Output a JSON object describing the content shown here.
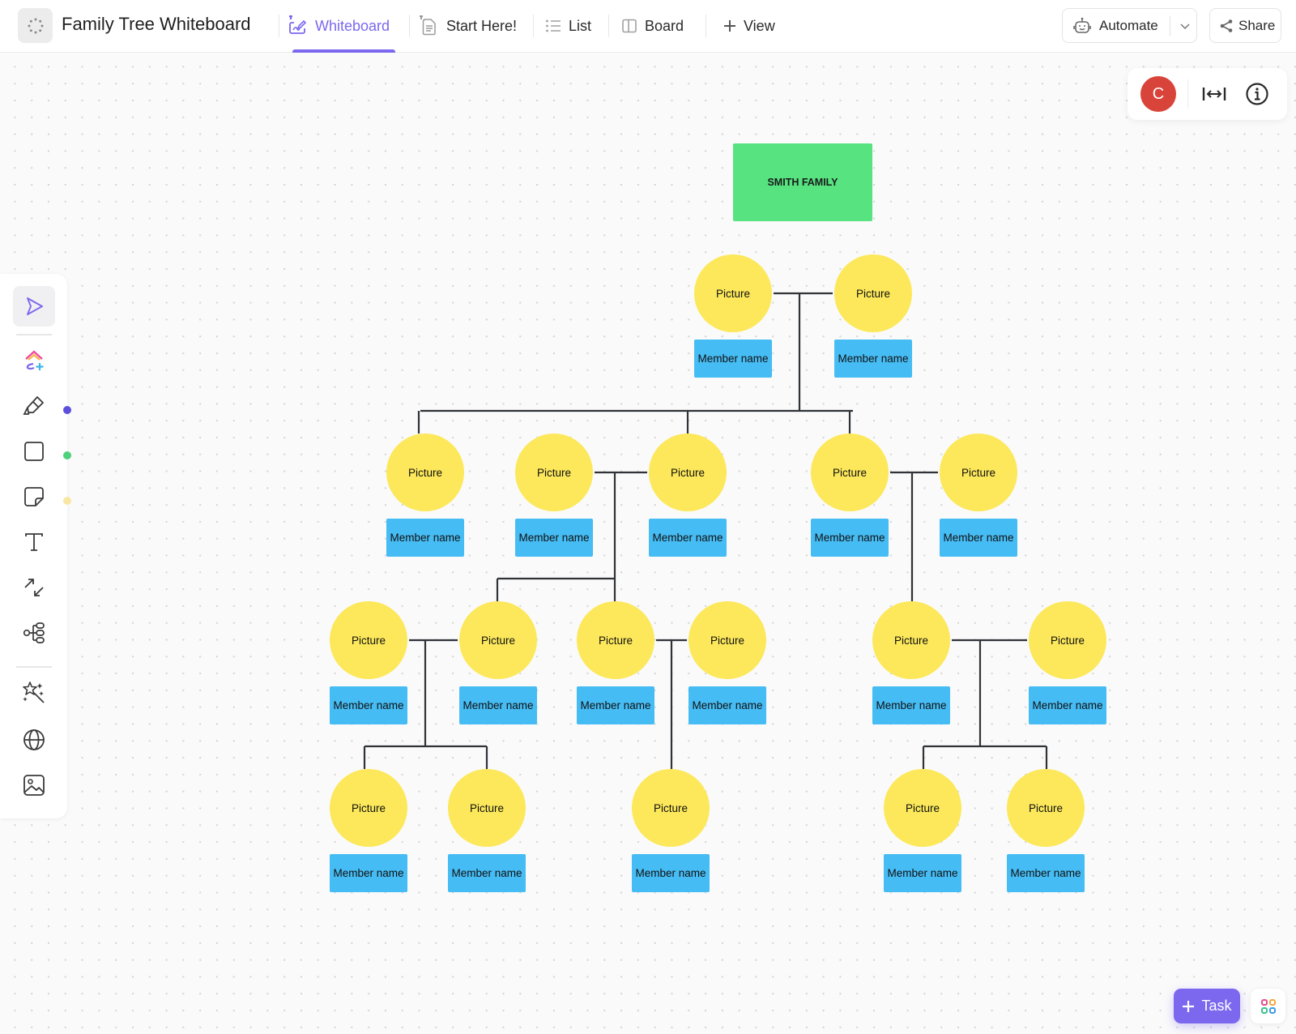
{
  "header": {
    "title": "Family Tree Whiteboard",
    "tabs": [
      {
        "label": "Whiteboard",
        "icon": "whiteboard-icon",
        "active": true,
        "pinned": true
      },
      {
        "label": "Start Here!",
        "icon": "doc-icon",
        "active": false,
        "pinned": true
      },
      {
        "label": "List",
        "icon": "list-icon",
        "active": false
      },
      {
        "label": "Board",
        "icon": "board-icon",
        "active": false
      },
      {
        "label": "View",
        "icon": "plus-icon",
        "active": false
      }
    ],
    "automate_label": "Automate",
    "share_label": "Share",
    "accent_color": "#7b68ee"
  },
  "toolbar": {
    "tools": [
      {
        "name": "select",
        "icon": "cursor-icon",
        "active": true
      },
      {
        "name": "clickup-ai",
        "icon": "ai-create-icon"
      },
      {
        "name": "pen",
        "icon": "pen-icon",
        "color": "#5b4fdc"
      },
      {
        "name": "shape",
        "icon": "square-icon",
        "color": "#4ed17a"
      },
      {
        "name": "sticky-note",
        "icon": "sticky-note-icon",
        "color": "#f8e7a4"
      },
      {
        "name": "text",
        "icon": "text-icon"
      },
      {
        "name": "connector",
        "icon": "connector-arrows-icon"
      },
      {
        "name": "mind-map",
        "icon": "mind-map-icon"
      },
      {
        "name": "ai-magic",
        "icon": "magic-wand-icon"
      },
      {
        "name": "embed",
        "icon": "globe-icon"
      },
      {
        "name": "image",
        "icon": "image-icon"
      }
    ]
  },
  "floating": {
    "avatar_initial": "C",
    "avatar_color": "#d9443a"
  },
  "footer": {
    "task_label": "Task"
  },
  "diagram": {
    "title": "SMITH FAMILY",
    "colors": {
      "title": "#56e380",
      "picture": "#fce85a",
      "name": "#46bcf4",
      "connector": "#2f3337"
    },
    "picture_label": "Picture",
    "name_label": "Member name",
    "members": [
      {
        "id": "g1a",
        "gen": 1,
        "picture": "Picture",
        "name": "Member name"
      },
      {
        "id": "g1b",
        "gen": 1,
        "picture": "Picture",
        "name": "Member name"
      },
      {
        "id": "g2a",
        "gen": 2,
        "picture": "Picture",
        "name": "Member name"
      },
      {
        "id": "g2b",
        "gen": 2,
        "picture": "Picture",
        "name": "Member name"
      },
      {
        "id": "g2c",
        "gen": 2,
        "picture": "Picture",
        "name": "Member name"
      },
      {
        "id": "g2d",
        "gen": 2,
        "picture": "Picture",
        "name": "Member name"
      },
      {
        "id": "g2e",
        "gen": 2,
        "picture": "Picture",
        "name": "Member name"
      },
      {
        "id": "g3a",
        "gen": 3,
        "picture": "Picture",
        "name": "Member name"
      },
      {
        "id": "g3b",
        "gen": 3,
        "picture": "Picture",
        "name": "Member name"
      },
      {
        "id": "g3c",
        "gen": 3,
        "picture": "Picture",
        "name": "Member name"
      },
      {
        "id": "g3d",
        "gen": 3,
        "picture": "Picture",
        "name": "Member name"
      },
      {
        "id": "g3e",
        "gen": 3,
        "picture": "Picture",
        "name": "Member name"
      },
      {
        "id": "g3f",
        "gen": 3,
        "picture": "Picture",
        "name": "Member name"
      },
      {
        "id": "g4a",
        "gen": 4,
        "picture": "Picture",
        "name": "Member name"
      },
      {
        "id": "g4b",
        "gen": 4,
        "picture": "Picture",
        "name": "Member name"
      },
      {
        "id": "g4c",
        "gen": 4,
        "picture": "Picture",
        "name": "Member name"
      },
      {
        "id": "g4d",
        "gen": 4,
        "picture": "Picture",
        "name": "Member name"
      },
      {
        "id": "g4e",
        "gen": 4,
        "picture": "Picture",
        "name": "Member name"
      }
    ],
    "couples": [
      {
        "partners": [
          "g1a",
          "g1b"
        ],
        "children": [
          "g2a",
          "g2c",
          "g2d"
        ]
      },
      {
        "partners": [
          "g2b",
          "g2c"
        ],
        "children": [
          "g3b",
          "g3c"
        ]
      },
      {
        "partners": [
          "g2d",
          "g2e"
        ],
        "children": [
          "g3e"
        ]
      },
      {
        "partners": [
          "g3a",
          "g3b"
        ],
        "children": [
          "g4a",
          "g4b"
        ]
      },
      {
        "partners": [
          "g3c",
          "g3d"
        ],
        "children": [
          "g4c"
        ]
      },
      {
        "partners": [
          "g3e",
          "g3f"
        ],
        "children": [
          "g4d",
          "g4e"
        ]
      }
    ]
  }
}
